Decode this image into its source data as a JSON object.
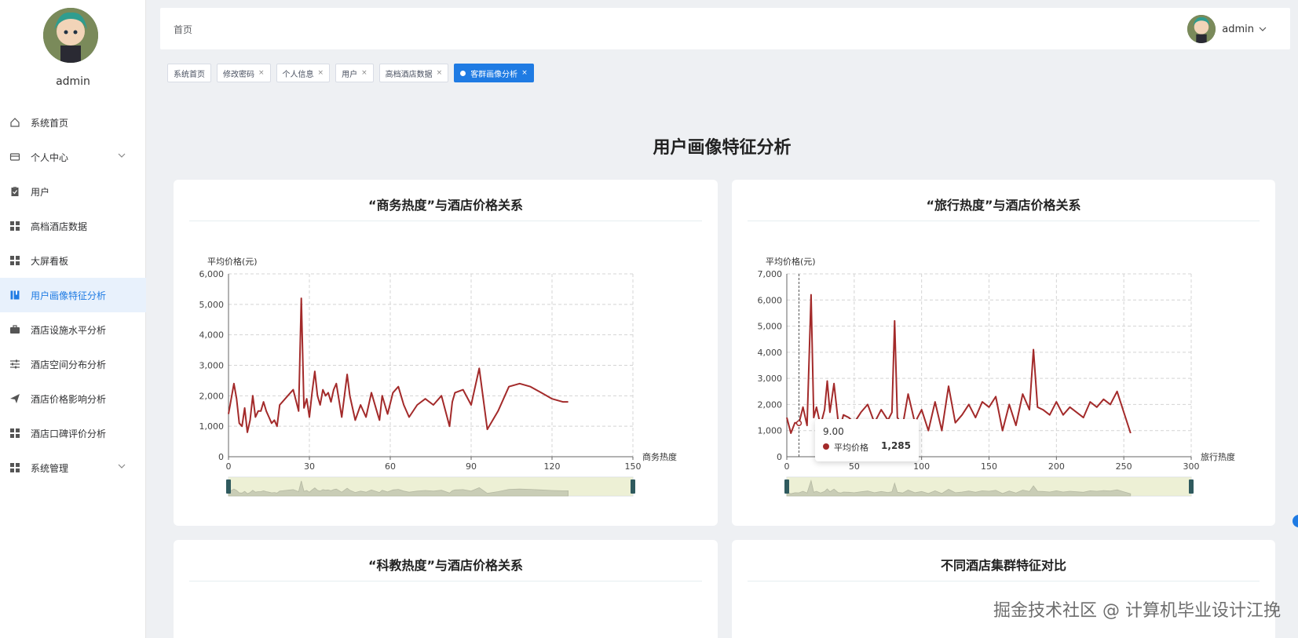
{
  "sidebar": {
    "username": "admin",
    "items": [
      {
        "label": "系统首页",
        "icon": "home-icon"
      },
      {
        "label": "个人中心",
        "icon": "wallet-icon",
        "chevron": true
      },
      {
        "label": "用户",
        "icon": "clipboard-icon"
      },
      {
        "label": "高档酒店数据",
        "icon": "grid-icon"
      },
      {
        "label": "大屏看板",
        "icon": "grid-icon"
      },
      {
        "label": "用户画像特征分析",
        "icon": "book-icon",
        "active": true
      },
      {
        "label": "酒店设施水平分析",
        "icon": "briefcase-icon"
      },
      {
        "label": "酒店空间分布分析",
        "icon": "sliders-icon"
      },
      {
        "label": "酒店价格影响分析",
        "icon": "send-icon"
      },
      {
        "label": "酒店口碑评价分析",
        "icon": "grid-icon"
      },
      {
        "label": "系统管理",
        "icon": "grid-icon",
        "chevron": true
      }
    ]
  },
  "header": {
    "breadcrumb": "首页",
    "username": "admin"
  },
  "tabs": [
    {
      "label": "系统首页",
      "closable": false
    },
    {
      "label": "修改密码",
      "closable": true
    },
    {
      "label": "个人信息",
      "closable": true
    },
    {
      "label": "用户",
      "closable": true
    },
    {
      "label": "高档酒店数据",
      "closable": true
    },
    {
      "label": "客群画像分析",
      "closable": true,
      "active": true
    }
  ],
  "page": {
    "title": "用户画像特征分析"
  },
  "cards": {
    "c1": {
      "title": "“商务热度”与酒店价格关系"
    },
    "c2": {
      "title": "“旅行热度”与酒店价格关系"
    },
    "c3": {
      "title": "“科教热度”与酒店价格关系"
    },
    "c4": {
      "title": "不同酒店集群特征对比"
    }
  },
  "tooltip": {
    "x": "9.00",
    "series": "平均价格",
    "value": "1,285"
  },
  "watermark": "掘金技术社区 @ 计算机毕业设计江挽",
  "colors": {
    "accent": "#1f7be3",
    "line": "#a32a2a"
  },
  "chart_data": [
    {
      "type": "line",
      "title": "“商务热度”与酒店价格关系",
      "xlabel": "商务热度",
      "ylabel": "平均价格(元)",
      "xlim": [
        0,
        150
      ],
      "ylim": [
        0,
        6000
      ],
      "xticks": [
        0,
        30,
        60,
        90,
        120,
        150
      ],
      "yticks": [
        0,
        1000,
        2000,
        3000,
        4000,
        5000,
        6000
      ],
      "series": [
        {
          "name": "平均价格",
          "x": [
            0,
            2,
            3,
            4,
            5,
            6,
            7,
            8,
            9,
            10,
            11,
            12,
            13,
            14,
            15,
            16,
            17,
            18,
            19,
            20,
            22,
            24,
            26,
            27,
            28,
            29,
            30,
            31,
            32,
            33,
            34,
            35,
            36,
            37,
            38,
            39,
            40,
            42,
            44,
            45,
            47,
            49,
            51,
            53,
            55,
            56,
            57,
            59,
            61,
            63,
            65,
            67,
            70,
            73,
            76,
            79,
            82,
            83,
            84,
            87,
            90,
            93,
            96,
            100,
            104,
            108,
            112,
            116,
            120,
            124,
            126
          ],
          "y": [
            1400,
            2400,
            1900,
            1100,
            1000,
            1600,
            800,
            1200,
            2000,
            1300,
            1500,
            1500,
            1800,
            1500,
            1300,
            1100,
            1200,
            1000,
            1700,
            1800,
            2000,
            2200,
            1500,
            5200,
            1600,
            1900,
            1300,
            2100,
            2800,
            2000,
            1700,
            2200,
            2000,
            2100,
            1800,
            2200,
            2400,
            1300,
            2700,
            2000,
            1200,
            1700,
            1300,
            2100,
            1500,
            1200,
            2000,
            1400,
            2100,
            2300,
            1700,
            1300,
            1700,
            1900,
            1700,
            2000,
            1000,
            1800,
            2100,
            2200,
            1700,
            2900,
            900,
            1500,
            2300,
            2400,
            2300,
            2100,
            1900,
            1800,
            1800
          ]
        }
      ]
    },
    {
      "type": "line",
      "title": "“旅行热度”与酒店价格关系",
      "xlabel": "旅行热度",
      "ylabel": "平均价格(元)",
      "xlim": [
        0,
        300
      ],
      "ylim": [
        0,
        7000
      ],
      "xticks": [
        0,
        50,
        100,
        150,
        200,
        250,
        300
      ],
      "yticks": [
        0,
        1000,
        2000,
        3000,
        4000,
        5000,
        6000,
        7000
      ],
      "series": [
        {
          "name": "平均价格",
          "x": [
            0,
            3,
            6,
            9,
            12,
            15,
            18,
            20,
            22,
            25,
            28,
            30,
            32,
            35,
            38,
            40,
            42,
            46,
            50,
            55,
            60,
            65,
            70,
            75,
            78,
            80,
            82,
            86,
            90,
            95,
            100,
            105,
            110,
            115,
            120,
            125,
            130,
            135,
            140,
            145,
            150,
            155,
            160,
            165,
            170,
            175,
            180,
            183,
            186,
            190,
            195,
            200,
            205,
            210,
            215,
            220,
            225,
            230,
            235,
            240,
            245,
            250,
            255
          ],
          "y": [
            1500,
            900,
            1300,
            1285,
            1900,
            1200,
            6200,
            1500,
            1900,
            1200,
            1800,
            2900,
            1700,
            2800,
            1400,
            1200,
            1600,
            1500,
            1300,
            1700,
            2000,
            1300,
            1800,
            1400,
            1700,
            5200,
            1500,
            1200,
            2400,
            1300,
            1800,
            1000,
            2100,
            1000,
            2700,
            1300,
            1600,
            2000,
            1500,
            2100,
            1900,
            2300,
            1000,
            2000,
            1200,
            2400,
            1800,
            4100,
            1900,
            1800,
            1600,
            2100,
            1600,
            1900,
            1700,
            1500,
            2100,
            1900,
            2200,
            2000,
            2500,
            1700,
            900
          ]
        }
      ]
    }
  ]
}
